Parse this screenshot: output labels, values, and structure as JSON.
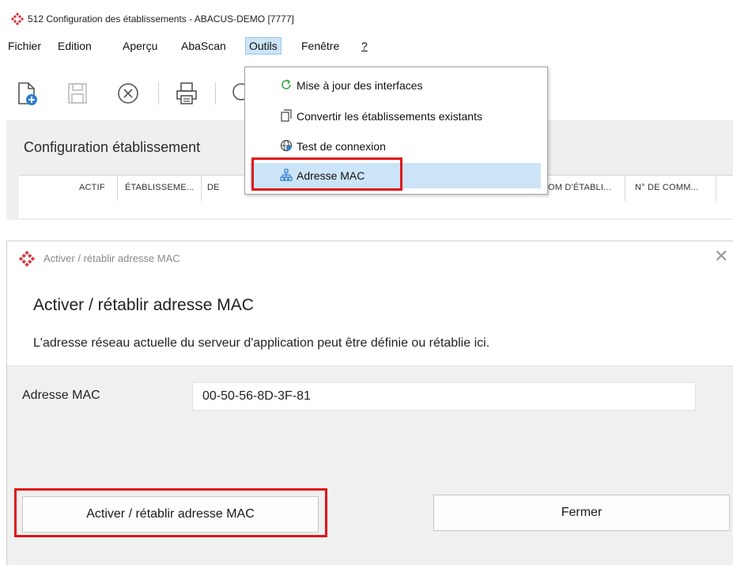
{
  "window": {
    "title": "512 Configuration des établissements - ABACUS-DEMO [7777]"
  },
  "menubar": {
    "items": [
      {
        "label": "Fichier"
      },
      {
        "label": "Edition"
      },
      {
        "label": "Aperçu"
      },
      {
        "label": "AbaScan"
      },
      {
        "label": "Outils",
        "active": true
      },
      {
        "label": "Fenêtre"
      },
      {
        "label": "?"
      }
    ]
  },
  "toolbar": {
    "icons": [
      "new-document-icon",
      "save-icon",
      "cancel-icon",
      "print-icon"
    ]
  },
  "outils_menu": {
    "items": [
      {
        "label": "Mise à jour des interfaces",
        "icon": "refresh-icon"
      },
      {
        "label": "Convertir les établissements existants",
        "icon": "convert-icon"
      },
      {
        "label": "Test de connexion",
        "icon": "connection-test-icon"
      },
      {
        "label": "Adresse MAC",
        "icon": "network-icon",
        "highlighted": true
      }
    ]
  },
  "main": {
    "section_title": "Configuration établissement",
    "columns": [
      "ACTIF",
      "ÉTABLISSEME...",
      "DE",
      "OM D'ÉTABLI...",
      "N° DE COMM..."
    ]
  },
  "dialog": {
    "title": "Activer / rétablir adresse MAC",
    "heading": "Activer / rétablir adresse MAC",
    "description": "L'adresse réseau actuelle du serveur d'application peut être définie ou rétablie ici.",
    "field_label": "Adresse MAC",
    "field_value": "00-50-56-8D-3F-81",
    "activate_button": "Activer / rétablir adresse MAC",
    "close_button": "Fermer"
  },
  "colors": {
    "highlight": "#cce4f7",
    "annotation_red": "#e0141a",
    "logo_red": "#d9363e"
  }
}
